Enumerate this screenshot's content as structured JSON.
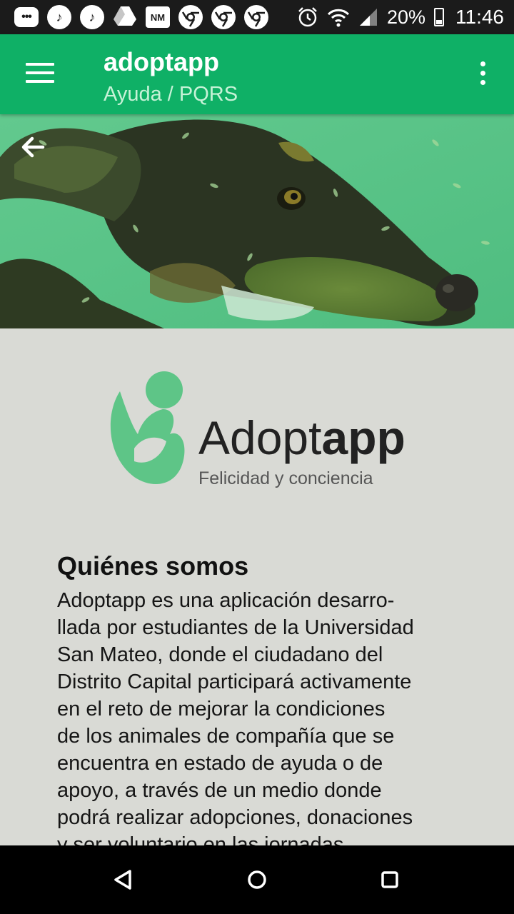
{
  "status_bar": {
    "icons": [
      "message-icon",
      "music-app-icon",
      "music-app-icon",
      "drive-icon",
      "nm-app-icon",
      "chrome-icon",
      "chrome-icon",
      "chrome-icon"
    ],
    "nm_label": "NM",
    "battery": "20%",
    "time": "11:46"
  },
  "app_bar": {
    "title": "adoptapp",
    "subtitle": "Ayuda / PQRS",
    "color": "#0fb066"
  },
  "hero": {
    "description_icon": "back-arrow-icon"
  },
  "logo": {
    "wordmark_regular": "Adopt",
    "wordmark_bold": "app",
    "tagline": "Felicidad y conciencia",
    "color": "#5ec587"
  },
  "about": {
    "title": "Quiénes somos",
    "body": "Adoptapp es una aplicación desarro-\nllada por estudiantes de la Universidad\nSan Mateo, donde el ciudadano del\nDistrito Capital participará activamente\nen el reto de mejorar la condiciones\nde los animales de compañía que se\nencuentra en estado de ayuda o de\napoyo, a través de un medio donde\npodrá realizar adopciones, donaciones\ny ser voluntario en las jornadas"
  },
  "nav_bar": {
    "buttons": [
      "back-triangle-icon",
      "home-circle-icon",
      "recents-square-icon"
    ]
  }
}
